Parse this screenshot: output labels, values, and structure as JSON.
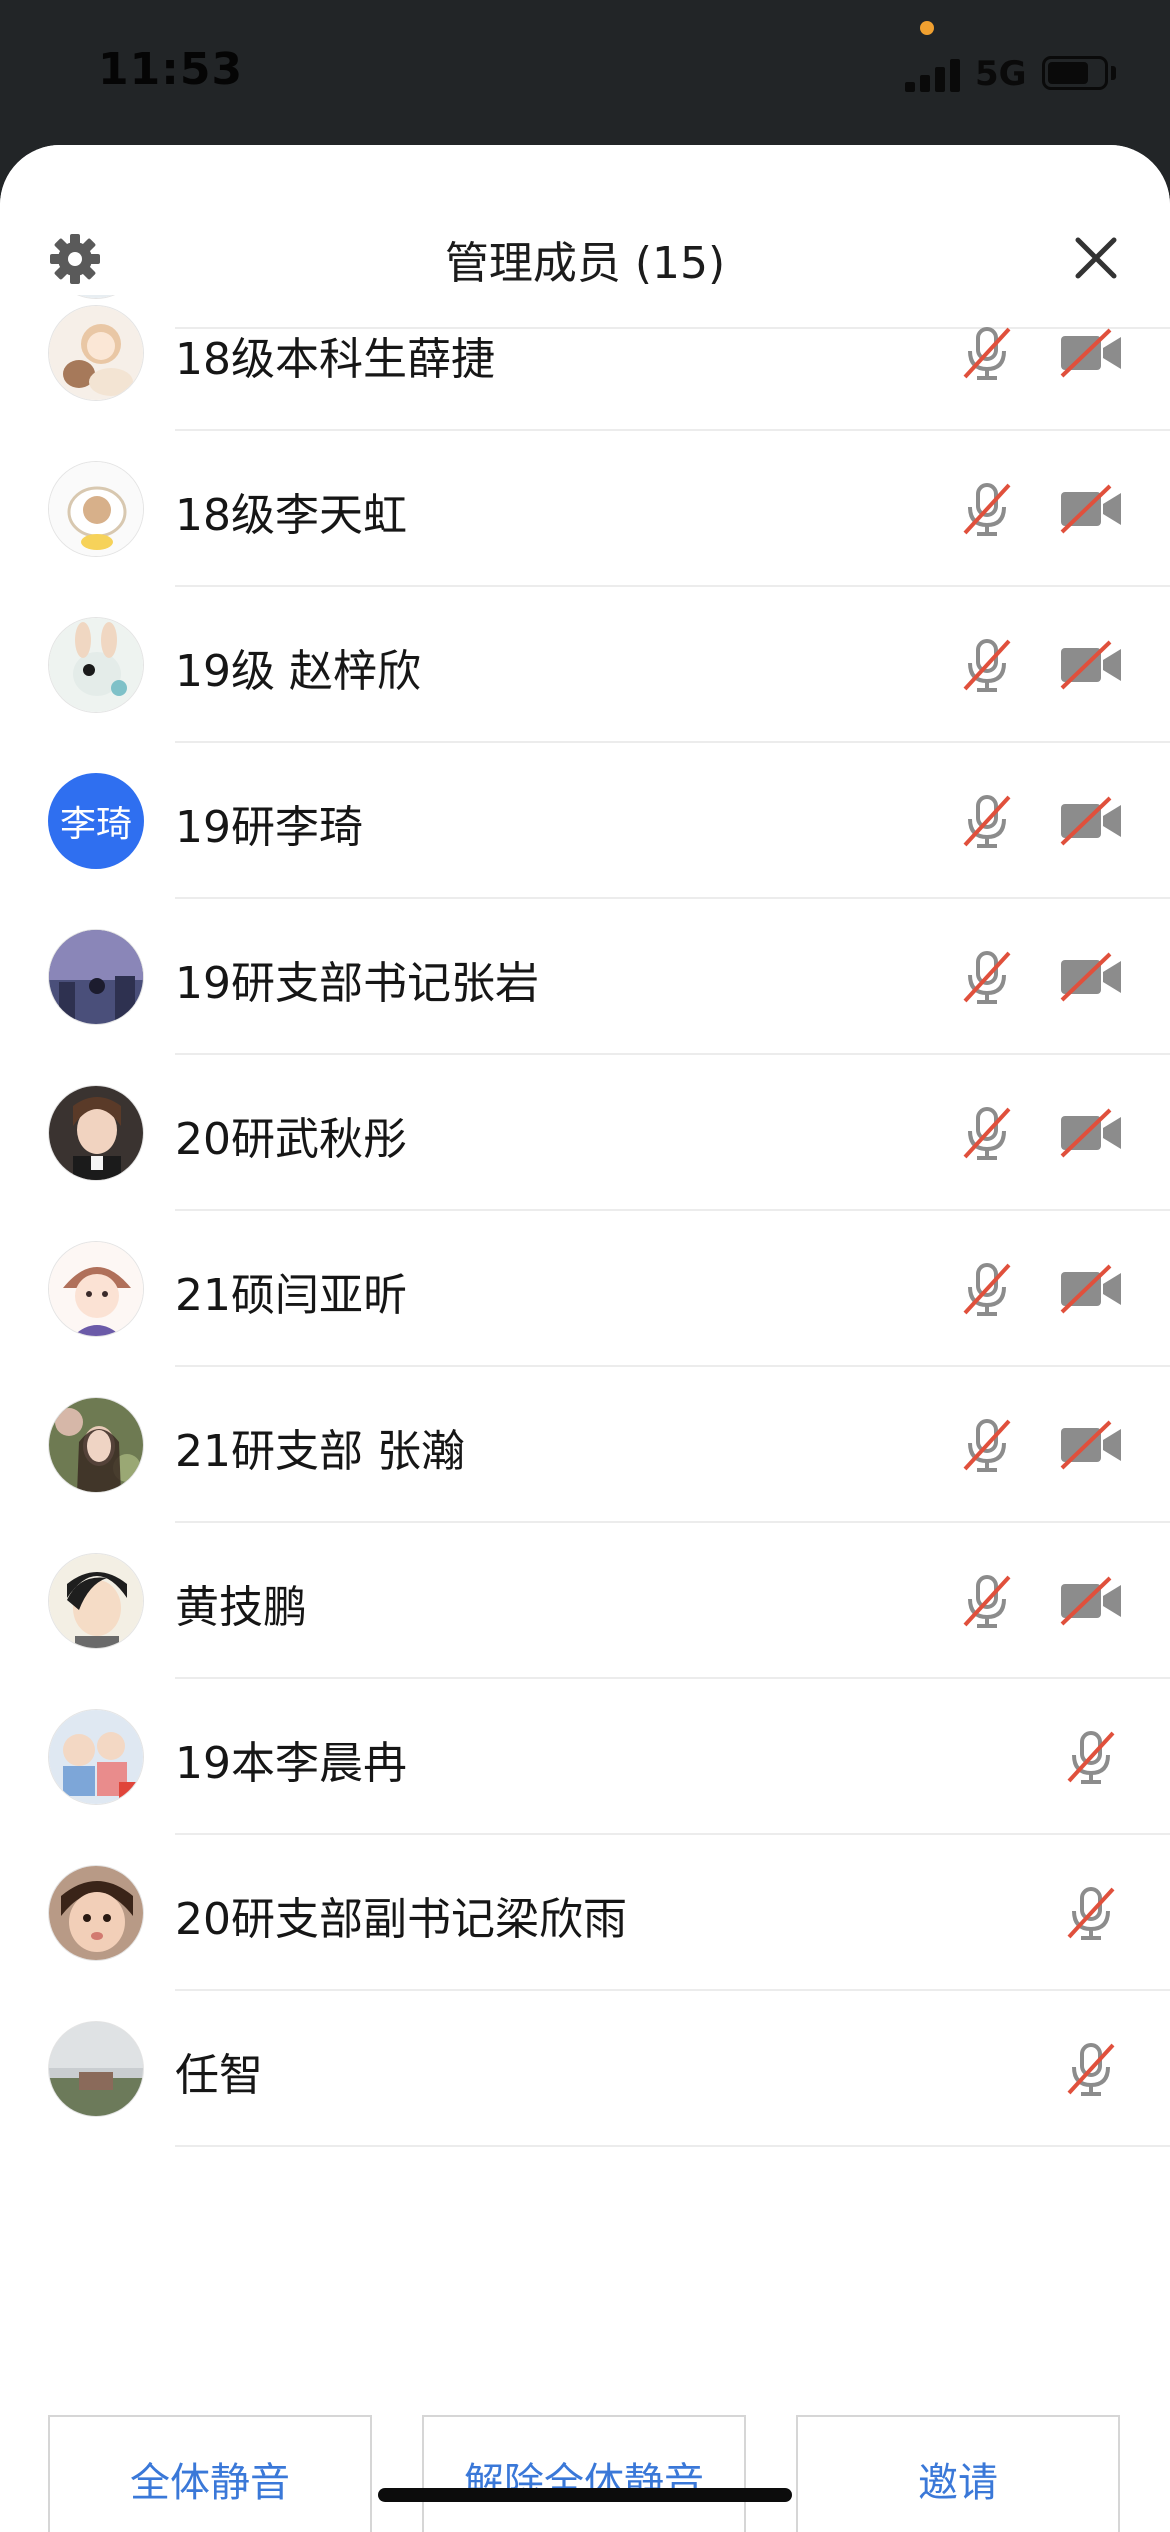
{
  "status_bar": {
    "time": "11:53",
    "network": "5G",
    "battery_level": 0.74,
    "signal_bars": 4
  },
  "header": {
    "title": "管理成员 (15)",
    "settings_icon": "gear-icon",
    "close_icon": "close-icon"
  },
  "members": [
    {
      "name": "18级本科生薛捷",
      "avatar": "cartoon-girl-bear",
      "mic_icon": "mic-muted-icon",
      "camera_icon": "camera-off-icon"
    },
    {
      "name": "18级李天虹",
      "avatar": "cartoon-sheep",
      "mic_icon": "mic-muted-icon",
      "camera_icon": "camera-off-icon"
    },
    {
      "name": "19级 赵梓欣",
      "avatar": "cartoon-rabbit",
      "mic_icon": "mic-muted-icon",
      "camera_icon": "camera-off-icon"
    },
    {
      "name": "19研李琦",
      "avatar_text": "李琦",
      "mic_icon": "mic-muted-icon",
      "camera_icon": "camera-off-icon"
    },
    {
      "name": "19研支部书记张岩",
      "avatar": "night-city",
      "mic_icon": "mic-muted-icon",
      "camera_icon": "camera-off-icon"
    },
    {
      "name": "20研武秋彤",
      "avatar": "portrait-girl",
      "mic_icon": "mic-muted-icon",
      "camera_icon": "camera-off-icon"
    },
    {
      "name": "21硕闫亚昕",
      "avatar": "cartoon-girl-hat",
      "mic_icon": "mic-muted-icon",
      "camera_icon": "camera-off-icon"
    },
    {
      "name": "21研支部 张瀚",
      "avatar": "portrait-flowers",
      "mic_icon": "mic-muted-icon",
      "camera_icon": "camera-off-icon"
    },
    {
      "name": "黄技鹏",
      "avatar": "cartoon-boy",
      "mic_icon": "mic-muted-icon",
      "camera_icon": "camera-off-icon"
    },
    {
      "name": "19本李晨冉",
      "avatar": "cartoon-family",
      "mic_icon": "mic-muted-icon"
    },
    {
      "name": "20研支部副书记梁欣雨",
      "avatar": "portrait-baby",
      "mic_icon": "mic-muted-icon"
    },
    {
      "name": "任智",
      "avatar": "landscape-rain",
      "mic_icon": "mic-muted-icon"
    }
  ],
  "footer": {
    "mute_all": "全体静音",
    "unmute_all": "解除全体静音",
    "invite": "邀请"
  },
  "colors": {
    "accent": "#3a78d8",
    "muted_slash": "#e0503c",
    "avatar_blue": "#2f6ff0"
  }
}
